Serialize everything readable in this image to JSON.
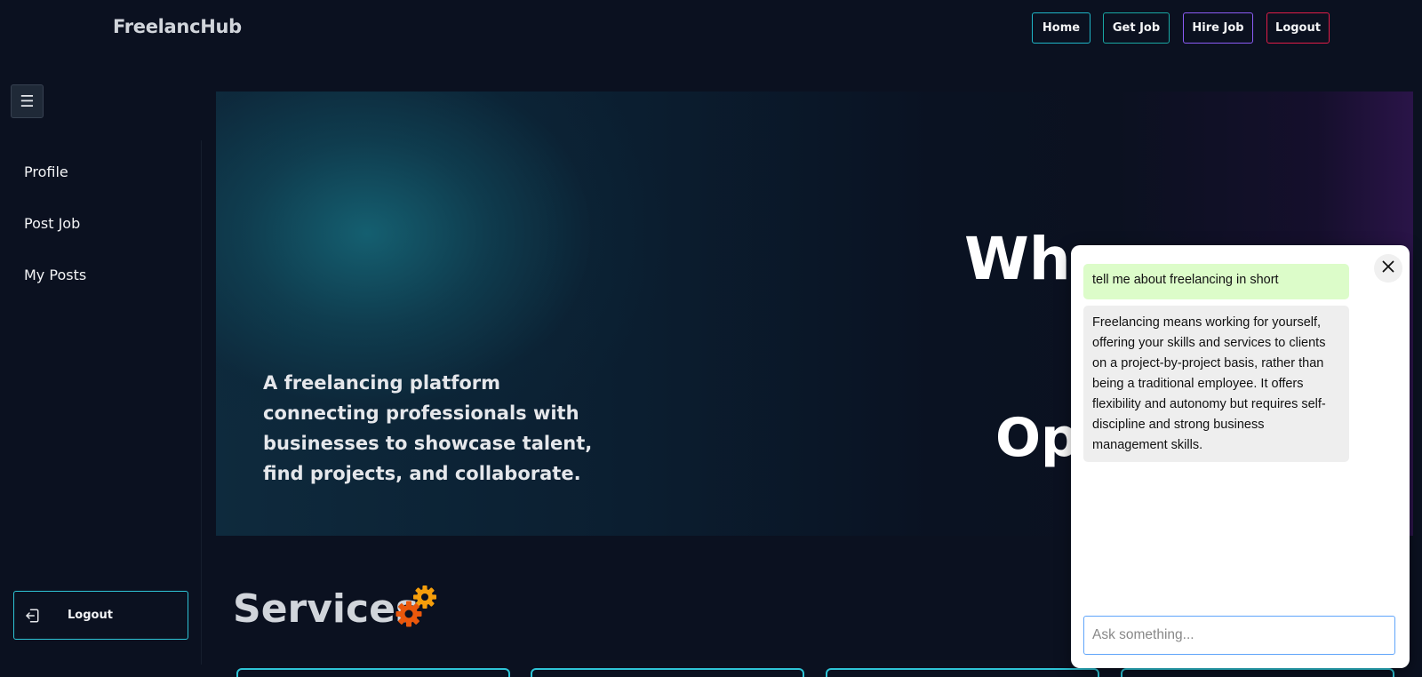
{
  "brand": "FreelancHub",
  "topnav": {
    "home": "Home",
    "get_job": "Get Job",
    "hire_job": "Hire Job",
    "logout": "Logout"
  },
  "menu_icon": "☰",
  "sidebar": {
    "items": [
      {
        "label": "Profile"
      },
      {
        "label": "Post Job"
      },
      {
        "label": "My Posts"
      }
    ],
    "logout_label": "Logout"
  },
  "hero": {
    "tagline": "A freelancing platform connecting professionals with businesses to showcase talent, find projects, and collaborate.",
    "heading_line1_visible": "Whe",
    "heading_line2_visible": "Op"
  },
  "services": {
    "title": "Services"
  },
  "chat": {
    "messages": [
      {
        "role": "user",
        "text": "tell me about freelancing in short"
      },
      {
        "role": "bot",
        "text": "Freelancing means working for yourself, offering your skills and services to clients on a project-by-project basis, rather than being a traditional employee. It offers flexibility and autonomy but requires self-discipline and strong business management skills."
      }
    ],
    "input_placeholder": "Ask something...",
    "close_icon": "close-icon"
  },
  "colors": {
    "background": "#0b1120",
    "accent_cyan": "#2ec4d6",
    "hire_border": "#8b5cf6",
    "logout_border": "#e11d48",
    "user_bubble": "#dcfcc9",
    "bot_bubble": "#eeeeee"
  }
}
